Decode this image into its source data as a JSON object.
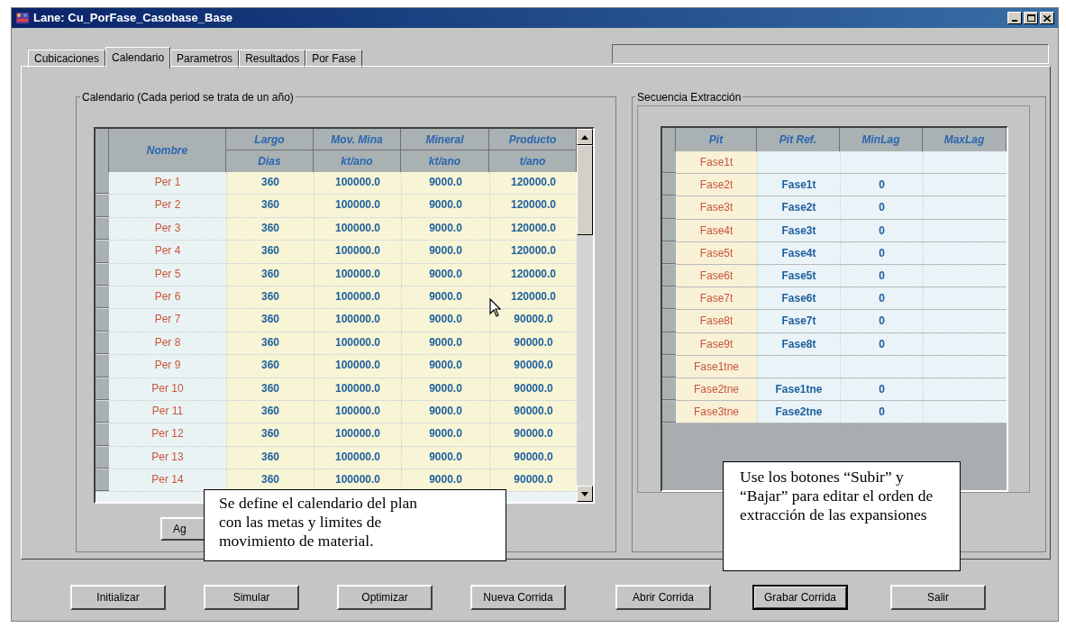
{
  "window": {
    "title": "Lane: Cu_PorFase_Casobase_Base"
  },
  "tabs": [
    {
      "label": "Cubicaciones",
      "selected": false
    },
    {
      "label": "Calendario",
      "selected": true
    },
    {
      "label": "Parametros",
      "selected": false
    },
    {
      "label": "Resultados",
      "selected": false
    },
    {
      "label": "Por Fase",
      "selected": false
    }
  ],
  "calendar": {
    "title": "Calendario (Cada period se trata de un año)",
    "columns": [
      {
        "label": "Nombre"
      },
      {
        "label": "Largo",
        "unit": "Dias"
      },
      {
        "label": "Mov. Mina",
        "unit": "kt/ano"
      },
      {
        "label": "Mineral",
        "unit": "kt/ano"
      },
      {
        "label": "Producto",
        "unit": "t/ano"
      }
    ],
    "rows": [
      {
        "name": "Per 1",
        "values": [
          "360",
          "100000.0",
          "9000.0",
          "120000.0"
        ]
      },
      {
        "name": "Per 2",
        "values": [
          "360",
          "100000.0",
          "9000.0",
          "120000.0"
        ]
      },
      {
        "name": "Per 3",
        "values": [
          "360",
          "100000.0",
          "9000.0",
          "120000.0"
        ]
      },
      {
        "name": "Per 4",
        "values": [
          "360",
          "100000.0",
          "9000.0",
          "120000.0"
        ]
      },
      {
        "name": "Per 5",
        "values": [
          "360",
          "100000.0",
          "9000.0",
          "120000.0"
        ]
      },
      {
        "name": "Per 6",
        "values": [
          "360",
          "100000.0",
          "9000.0",
          "120000.0"
        ]
      },
      {
        "name": "Per 7",
        "values": [
          "360",
          "100000.0",
          "9000.0",
          "90000.0"
        ]
      },
      {
        "name": "Per 8",
        "values": [
          "360",
          "100000.0",
          "9000.0",
          "90000.0"
        ]
      },
      {
        "name": "Per 9",
        "values": [
          "360",
          "100000.0",
          "9000.0",
          "90000.0"
        ]
      },
      {
        "name": "Per 10",
        "values": [
          "360",
          "100000.0",
          "9000.0",
          "90000.0"
        ]
      },
      {
        "name": "Per 11",
        "values": [
          "360",
          "100000.0",
          "9000.0",
          "90000.0"
        ]
      },
      {
        "name": "Per 12",
        "values": [
          "360",
          "100000.0",
          "9000.0",
          "90000.0"
        ]
      },
      {
        "name": "Per 13",
        "values": [
          "360",
          "100000.0",
          "9000.0",
          "90000.0"
        ]
      },
      {
        "name": "Per 14",
        "values": [
          "360",
          "100000.0",
          "9000.0",
          "90000.0"
        ]
      }
    ],
    "add_button": "Ag"
  },
  "sequence": {
    "title": "Secuencia Extracción",
    "columns": [
      "Pit",
      "Pit Ref.",
      "MinLag",
      "MaxLag"
    ],
    "rows": [
      {
        "pit": "Fase1t"
      },
      {
        "pit": "Fase2t",
        "pit_ref": "Fase1t",
        "min_lag": "0"
      },
      {
        "pit": "Fase3t",
        "pit_ref": "Fase2t",
        "min_lag": "0"
      },
      {
        "pit": "Fase4t",
        "pit_ref": "Fase3t",
        "min_lag": "0"
      },
      {
        "pit": "Fase5t",
        "pit_ref": "Fase4t",
        "min_lag": "0"
      },
      {
        "pit": "Fase6t",
        "pit_ref": "Fase5t",
        "min_lag": "0"
      },
      {
        "pit": "Fase7t",
        "pit_ref": "Fase6t",
        "min_lag": "0"
      },
      {
        "pit": "Fase8t",
        "pit_ref": "Fase7t",
        "min_lag": "0"
      },
      {
        "pit": "Fase9t",
        "pit_ref": "Fase8t",
        "min_lag": "0"
      },
      {
        "pit": "Fase1tne"
      },
      {
        "pit": "Fase2tne",
        "pit_ref": "Fase1tne",
        "min_lag": "0"
      },
      {
        "pit": "Fase3tne",
        "pit_ref": "Fase2tne",
        "min_lag": "0"
      }
    ]
  },
  "callouts": [
    "Se define el calendario del plan con las metas y limites de movimiento de material.",
    "Use los botones “Subir” y “Bajar” para editar el orden de extracción de las expansiones"
  ],
  "buttons": [
    {
      "label": "Initializar",
      "default": false
    },
    {
      "label": "Simular",
      "default": false
    },
    {
      "label": "Optimizar",
      "default": false
    },
    {
      "label": "Nueva Corrida",
      "default": false
    },
    {
      "label": "Abrir Corrida",
      "default": false
    },
    {
      "label": "Grabar Corrida",
      "default": true
    },
    {
      "label": "Salir",
      "default": false
    }
  ]
}
